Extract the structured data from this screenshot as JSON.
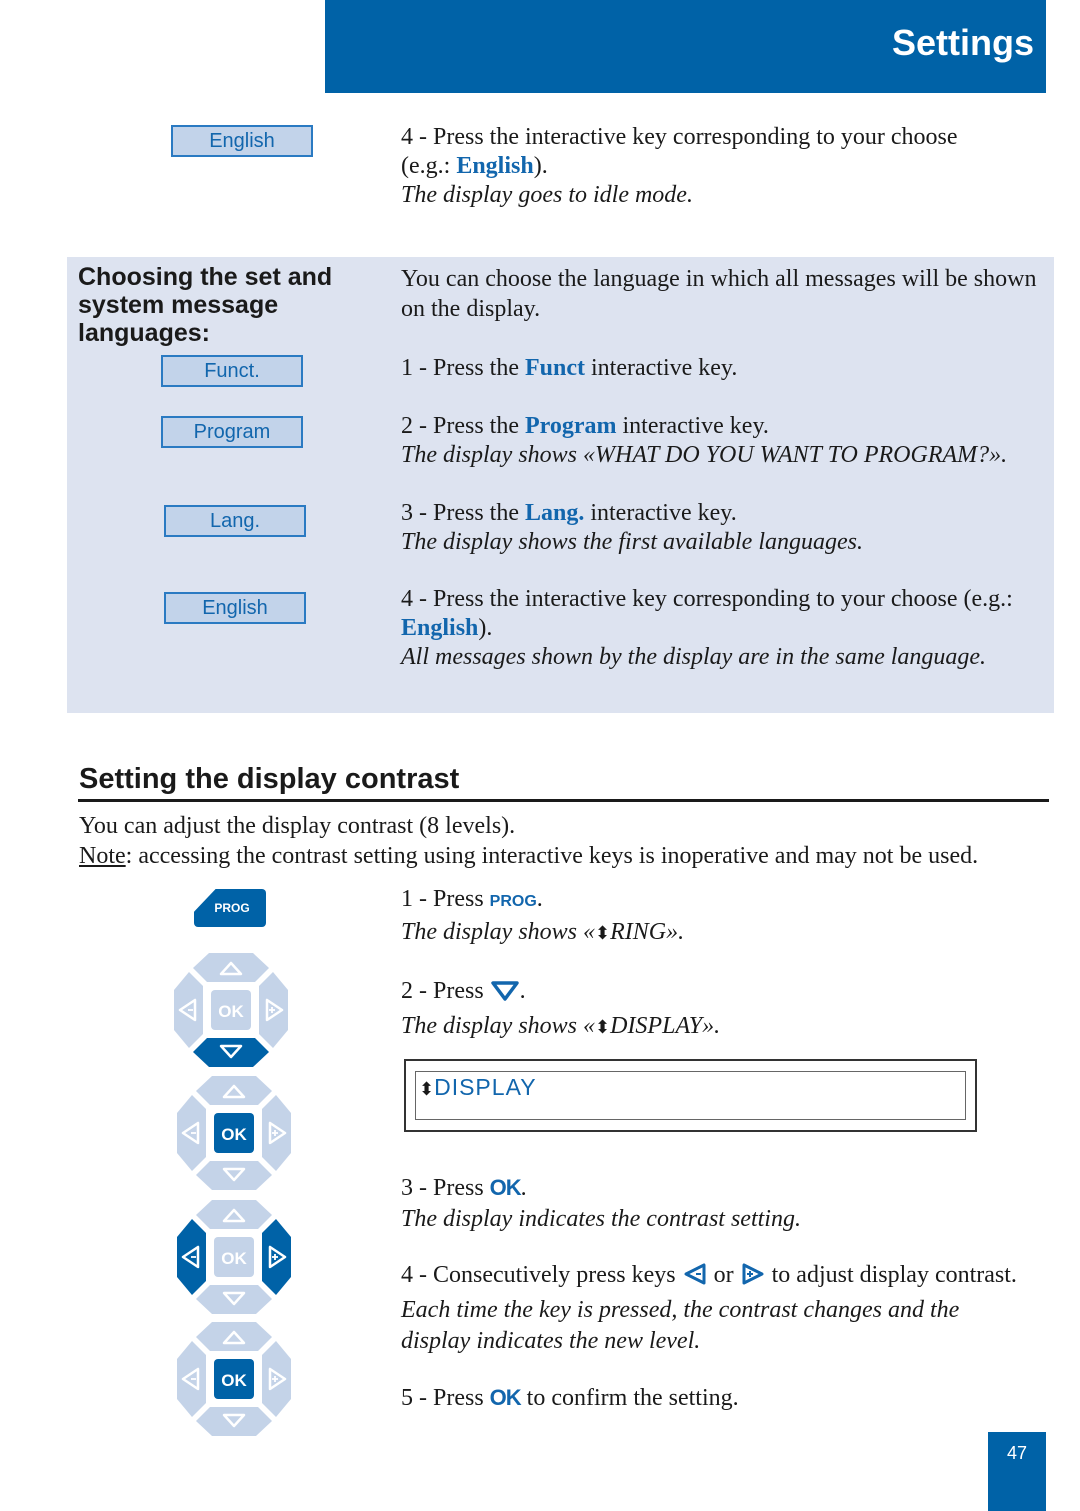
{
  "header": {
    "title": "Settings"
  },
  "top_step": {
    "softkey": "English",
    "step_prefix": "4 - Press the interactive key corresponding to your choose",
    "eg_open": "(e.g.: ",
    "eg_keyword": "English",
    "eg_close": ").",
    "result": "The display goes to idle mode."
  },
  "language_panel": {
    "title": "Choosing the set and system message languages:",
    "intro": "You can choose the language in which all messages will be shown on the display.",
    "softkeys": [
      "Funct.",
      "Program",
      "Lang.",
      "English"
    ],
    "steps": [
      {
        "prefix": "1 - Press the ",
        "keyword": "Funct",
        "suffix": " interactive key.",
        "result": ""
      },
      {
        "prefix": "2 - Press the ",
        "keyword": "Program",
        "suffix": " interactive key.",
        "result": "The display shows «WHAT DO YOU WANT TO PROGRAM?»."
      },
      {
        "prefix": "3 - Press the ",
        "keyword": "Lang.",
        "suffix": " interactive key.",
        "result": "The display shows the first available languages."
      },
      {
        "prefix": "4 - Press the interactive key corresponding to your choose (e.g.: ",
        "keyword": "English",
        "suffix": ").",
        "result": "All messages shown by the display are in the same language."
      }
    ]
  },
  "contrast_section": {
    "title": "Setting the display contrast",
    "intro": "You can adjust the display contrast (8 levels).",
    "note_label": "Note",
    "note_text": ": accessing the contrast setting using interactive keys is inoperative and may not be used.",
    "prog_key_label": "PROG",
    "ok_label": "OK",
    "steps": [
      {
        "prefix": "1 - Press ",
        "key": "PROG",
        "suffix": ".",
        "result_prefix": "The display shows «",
        "result_icon": "⬍",
        "result_value": "RING",
        "result_suffix": "»."
      },
      {
        "prefix": "2 - Press ",
        "key": "down-arrow",
        "suffix": ".",
        "result_prefix": "The display shows «",
        "result_icon": "⬍",
        "result_value": "DISPLAY",
        "result_suffix": "»."
      },
      {
        "prefix": "3 - Press ",
        "key": "OK",
        "suffix": ".",
        "result": "The display indicates the contrast setting."
      },
      {
        "prefix": "4 - Consecutively press keys ",
        "or": " or ",
        "suffix": " to adjust display contrast.",
        "result_line1": "Each time the key is pressed, the contrast changes and the",
        "result_line2": "display indicates the new level."
      },
      {
        "prefix": "5 - Press ",
        "key": "OK",
        "suffix": " to confirm the setting."
      }
    ],
    "lcd": {
      "icon": "⬍",
      "text": "DISPLAY"
    }
  },
  "footer": {
    "page_number": "47"
  },
  "colors": {
    "brand_blue": "#0062a7",
    "keyword_blue": "#1266ad",
    "panel_bg": "#dde3f0",
    "softkey_bg": "#c2d3ea",
    "pad_light": "#c4d3e8"
  }
}
